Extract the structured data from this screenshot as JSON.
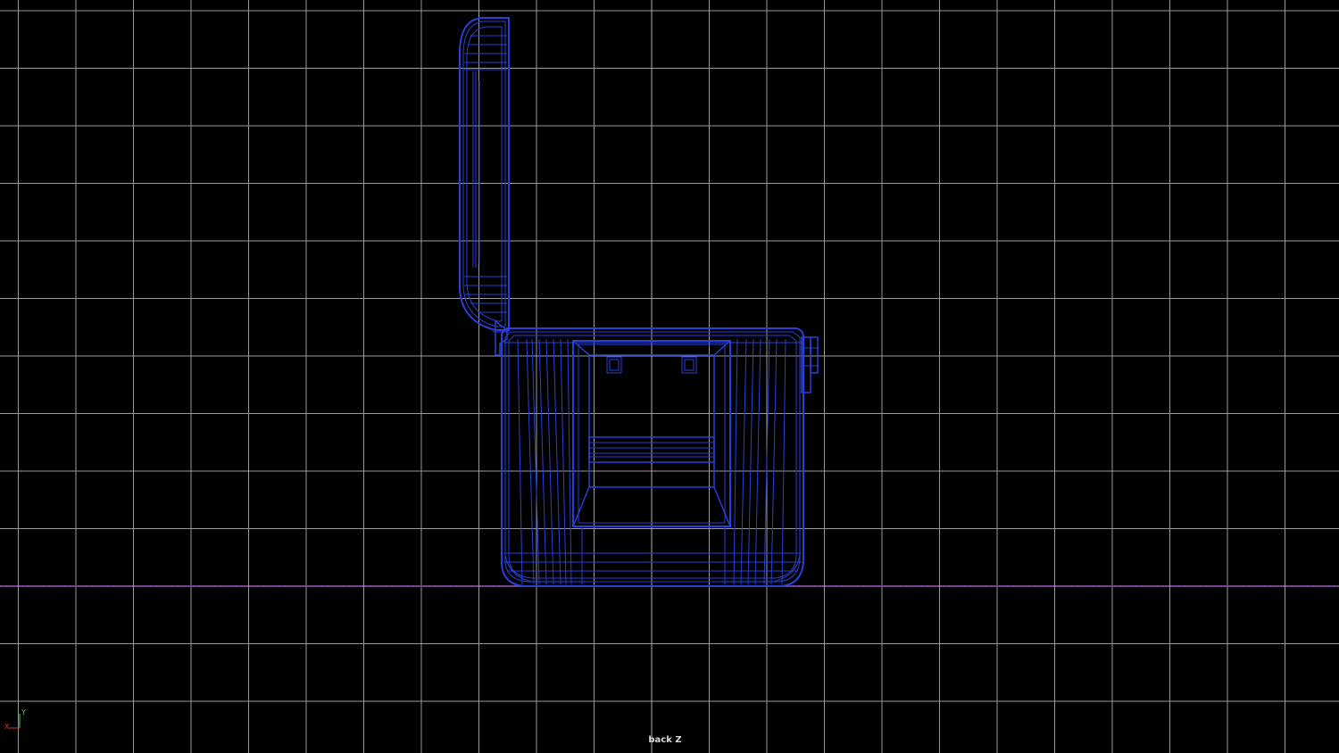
{
  "viewport": {
    "view_name": "back Z",
    "background_color": "#000000",
    "grid_color": "#9a9a9a",
    "axis_line_color": "#c0a8a8",
    "ground_line_color": "#8a3fb0",
    "wireframe_color": "#2840d8",
    "wireframe_highlight_color": "#5a70ff"
  },
  "axis_gizmo": {
    "y_label": "Y",
    "x_label": "X",
    "y_color": "#4ccf4c",
    "x_color": "#d43a3a"
  }
}
